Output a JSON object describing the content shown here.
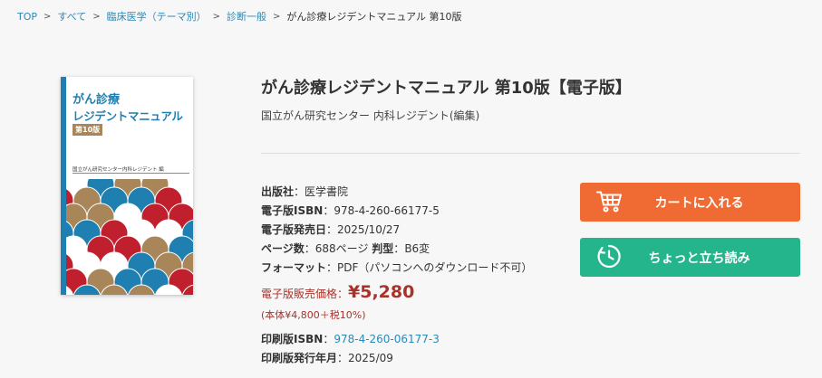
{
  "breadcrumb": {
    "items": [
      "TOP",
      "すべて",
      "臨床医学（テーマ別）",
      "診断一般"
    ],
    "current": "がん診療レジデントマニュアル 第10版"
  },
  "cover": {
    "title_line1": "がん診療",
    "title_line2": "レジデントマニュアル",
    "edition": "第10版",
    "author": "国立がん研究センター内科レジデント 編",
    "colors": {
      "blue": "#1e7fb0",
      "red": "#c0202e",
      "gold": "#a8865a"
    }
  },
  "product": {
    "title": "がん診療レジデントマニュアル 第10版【電子版】",
    "author": "国立がん研究センター 内科レジデント(編集)"
  },
  "specs": {
    "publisher_label": "出版社",
    "publisher": "医学書院",
    "eisbn_label": "電子版ISBN",
    "eisbn": "978-4-260-66177-5",
    "edate_label": "電子版発売日",
    "edate": "2025/10/27",
    "pages_label": "ページ数",
    "pages": "688ページ",
    "format_size_label": "判型",
    "format_size": "B6変",
    "format_label": "フォーマット",
    "format": "PDF（パソコンへのダウンロード不可）",
    "price_label": "電子版販売価格：",
    "price": "¥5,280",
    "price_detail": "(本体¥4,800＋税10%)",
    "print_isbn_label": "印刷版ISBN",
    "print_isbn": "978-4-260-06177-3",
    "print_date_label": "印刷版発行年月",
    "print_date": "2025/09"
  },
  "buttons": {
    "cart": "カートに入れる",
    "preview": "ちょっと立ち読み",
    "cart_icon": "cart-icon",
    "preview_icon": "clock-icon",
    "cart_color": "#f06a33",
    "preview_color": "#25b58d"
  }
}
